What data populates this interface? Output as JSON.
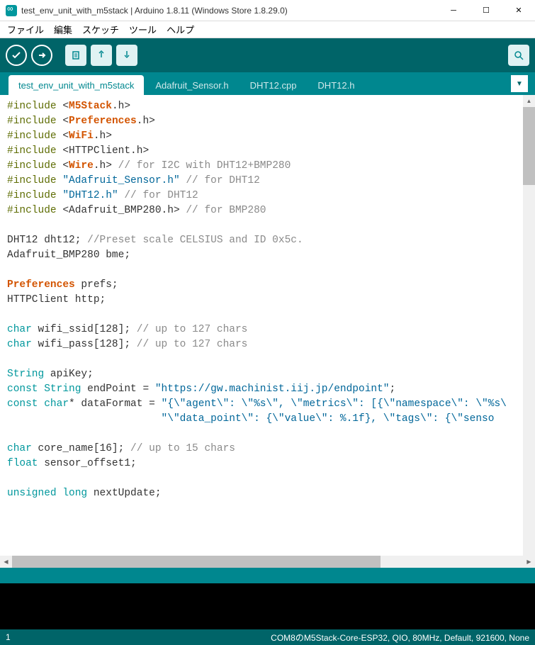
{
  "titlebar": {
    "text": "test_env_unit_with_m5stack | Arduino 1.8.11 (Windows Store 1.8.29.0)"
  },
  "menubar": {
    "file": "ファイル",
    "edit": "編集",
    "sketch": "スケッチ",
    "tools": "ツール",
    "help": "ヘルプ"
  },
  "tabs": {
    "t0": "test_env_unit_with_m5stack",
    "t1": "Adafruit_Sensor.h",
    "t2": "DHT12.cpp",
    "t3": "DHT12.h"
  },
  "code": {
    "l1a": "#include",
    "l1b": "M5Stack",
    "l1c": ".h>",
    "l2a": "#include",
    "l2b": "Preferences",
    "l2c": ".h>",
    "l3a": "#include",
    "l3b": "WiFi",
    "l3c": ".h>",
    "l4a": "#include",
    "l4b": " <HTTPClient.h>",
    "l5a": "#include",
    "l5b": "Wire",
    "l5c": ".h> ",
    "l5d": "// for I2C with DHT12+BMP280",
    "l6a": "#include",
    "l6b": " \"Adafruit_Sensor.h\"",
    "l6c": " // for DHT12",
    "l7a": "#include",
    "l7b": " \"DHT12.h\"",
    "l7c": " // for DHT12",
    "l8a": "#include",
    "l8b": " <Adafruit_BMP280.h> ",
    "l8c": "// for BMP280",
    "l10": "DHT12 dht12; ",
    "l10b": "//Preset scale CELSIUS and ID 0x5c.",
    "l11": "Adafruit_BMP280 bme;",
    "l13a": "Preferences",
    "l13b": " prefs;",
    "l14": "HTTPClient http;",
    "l16a": "char",
    "l16b": " wifi_ssid[128]; ",
    "l16c": "// up to 127 chars",
    "l17a": "char",
    "l17b": " wifi_pass[128]; ",
    "l17c": "// up to 127 chars",
    "l19a": "String",
    "l19b": " apiKey;",
    "l20a": "const",
    "l20b": " String",
    "l20c": " endPoint = ",
    "l20d": "\"https://gw.machinist.iij.jp/endpoint\"",
    "l20e": ";",
    "l21a": "const",
    "l21b": " char",
    "l21c": "* dataFormat = ",
    "l21d": "\"{\\\"agent\\\": \\\"%s\\\", \\\"metrics\\\": [{\\\"namespace\\\": \\\"%s\\",
    "l22a": "                         ",
    "l22b": "\"\\\"data_point\\\": {\\\"value\\\": %.1f}, \\\"tags\\\": {\\\"senso",
    "l24a": "char",
    "l24b": " core_name[16]; ",
    "l24c": "// up to 15 chars",
    "l25a": "float",
    "l25b": " sensor_offset1;",
    "l27a": "unsigned",
    "l27b": " long",
    "l27c": " nextUpdate;"
  },
  "status": {
    "line": "1",
    "board": "COM8のM5Stack-Core-ESP32, QIO, 80MHz, Default, 921600, None"
  }
}
